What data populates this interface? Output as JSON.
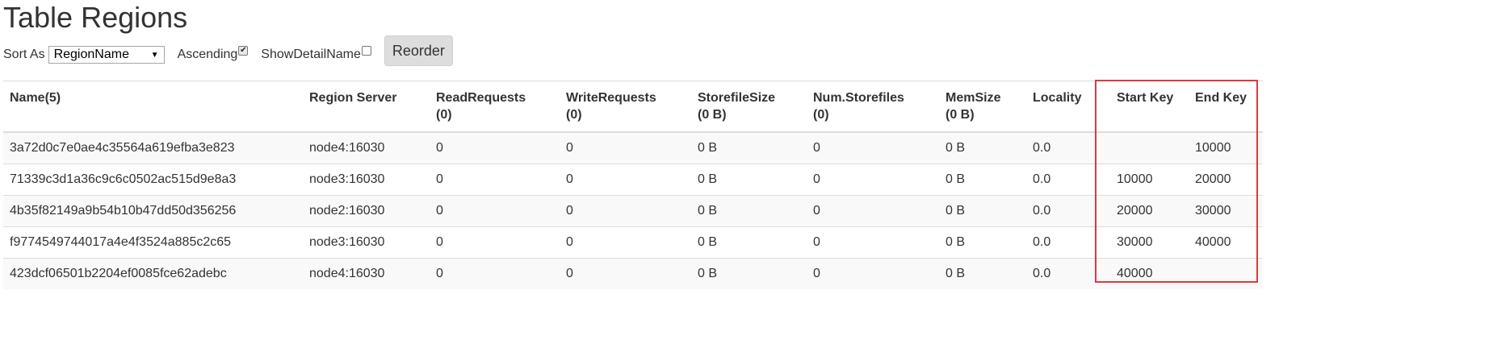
{
  "page": {
    "title": "Table Regions"
  },
  "controls": {
    "sort_label": "Sort As",
    "sort_value": "RegionName",
    "ascending_label": "Ascending",
    "ascending_checked": true,
    "show_detail_label": "ShowDetailName",
    "show_detail_checked": false,
    "reorder_label": "Reorder"
  },
  "table": {
    "headers": {
      "name": "Name(5)",
      "region_server": "Region Server",
      "read_requests": "ReadRequests",
      "read_requests_total": "(0)",
      "write_requests": "WriteRequests",
      "write_requests_total": "(0)",
      "storefile_size": "StorefileSize",
      "storefile_size_total": "(0 B)",
      "num_storefiles": "Num.Storefiles",
      "num_storefiles_total": "(0)",
      "memsize": "MemSize",
      "memsize_total": "(0 B)",
      "locality": "Locality",
      "start_key": "Start Key",
      "end_key": "End Key"
    },
    "rows": [
      {
        "name": "3a72d0c7e0ae4c35564a619efba3e823",
        "server": "node4:16030",
        "read": "0",
        "write": "0",
        "storefile_size": "0 B",
        "num_storefiles": "0",
        "memsize": "0 B",
        "locality": "0.0",
        "start_key": "",
        "end_key": "10000"
      },
      {
        "name": "71339c3d1a36c9c6c0502ac515d9e8a3",
        "server": "node3:16030",
        "read": "0",
        "write": "0",
        "storefile_size": "0 B",
        "num_storefiles": "0",
        "memsize": "0 B",
        "locality": "0.0",
        "start_key": "10000",
        "end_key": "20000"
      },
      {
        "name": "4b35f82149a9b54b10b47dd50d356256",
        "server": "node2:16030",
        "read": "0",
        "write": "0",
        "storefile_size": "0 B",
        "num_storefiles": "0",
        "memsize": "0 B",
        "locality": "0.0",
        "start_key": "20000",
        "end_key": "30000"
      },
      {
        "name": "f9774549744017a4e4f3524a885c2c65",
        "server": "node3:16030",
        "read": "0",
        "write": "0",
        "storefile_size": "0 B",
        "num_storefiles": "0",
        "memsize": "0 B",
        "locality": "0.0",
        "start_key": "30000",
        "end_key": "40000"
      },
      {
        "name": "423dcf06501b2204ef0085fce62adebc",
        "server": "node4:16030",
        "read": "0",
        "write": "0",
        "storefile_size": "0 B",
        "num_storefiles": "0",
        "memsize": "0 B",
        "locality": "0.0",
        "start_key": "40000",
        "end_key": ""
      }
    ]
  },
  "colors": {
    "link": "#337ab7",
    "highlight_border": "#e0393e",
    "stripe": "#f9f9f9",
    "button_bg": "#dddddd"
  },
  "icons": {
    "select_arrow": "chevron-down-icon",
    "ascending_checkbox": "checkbox-checked-icon",
    "show_detail_checkbox": "checkbox-unchecked-icon"
  }
}
